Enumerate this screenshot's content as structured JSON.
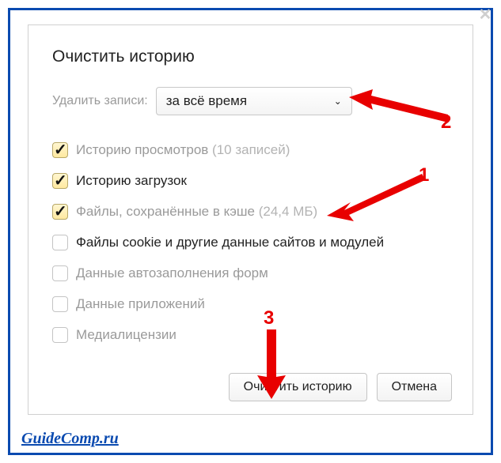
{
  "dialog": {
    "title": "Очистить историю",
    "delete_label": "Удалить записи:",
    "range_selected": "за всё время"
  },
  "options": [
    {
      "label": "Историю просмотров",
      "hint": "(10 записей)",
      "checked": true,
      "strong": false
    },
    {
      "label": "Историю загрузок",
      "hint": "",
      "checked": true,
      "strong": true
    },
    {
      "label": "Файлы, сохранённые в кэше",
      "hint": "(24,4 МБ)",
      "checked": true,
      "strong": false
    },
    {
      "label": "Файлы cookie и другие данные сайтов и модулей",
      "hint": "",
      "checked": false,
      "strong": true
    },
    {
      "label": "Данные автозаполнения форм",
      "hint": "",
      "checked": false,
      "strong": false
    },
    {
      "label": "Данные приложений",
      "hint": "",
      "checked": false,
      "strong": false
    },
    {
      "label": "Медиалицензии",
      "hint": "",
      "checked": false,
      "strong": false
    }
  ],
  "buttons": {
    "clear": "Очистить историю",
    "cancel": "Отмена"
  },
  "annotations": {
    "n1": "1",
    "n2": "2",
    "n3": "3"
  },
  "watermark": "GuideComp.ru"
}
